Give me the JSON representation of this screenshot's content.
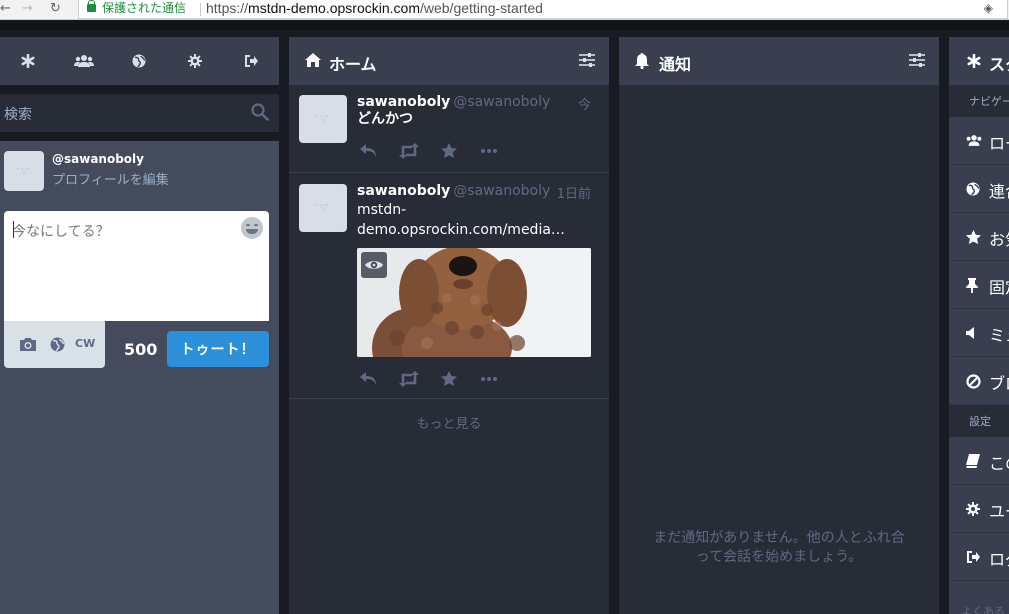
{
  "browser": {
    "secure_label": "保護された通信",
    "url_scheme": "https://",
    "url_host": "mstdn-demo.opsrockin.com",
    "url_path": "/web/getting-started"
  },
  "drawer": {
    "tab_icons": [
      "asterisk-icon",
      "users-icon",
      "globe-icon",
      "gear-icon",
      "sign-out-icon"
    ],
    "search_placeholder": "検索",
    "account_handle": "@sawanoboly",
    "edit_profile": "プロフィールを編集",
    "compose_placeholder": "今なにしてる？",
    "char_count": "500",
    "toot_button": "トゥート！",
    "cw_label": "CW"
  },
  "home": {
    "title": "ホーム",
    "statuses": [
      {
        "display_name": "sawanoboly",
        "handle": "@sawanoboly",
        "time": "今",
        "text": "どんかつ"
      },
      {
        "display_name": "sawanoboly",
        "handle": "@sawanoboly",
        "time": "1日前",
        "text_line1": "mstdn-",
        "text_line2": "demo.opsrockin.com/media…"
      }
    ],
    "load_more": "もっと見る"
  },
  "notifications": {
    "title": "通知",
    "empty_line1": "まだ通知がありません。他の人とふれ合",
    "empty_line2": "って会話を始めましょう。"
  },
  "getting_started": {
    "title": "スタ",
    "section_navigation": "ナビゲー",
    "section_settings": "設定",
    "footer": "よくある",
    "nav_items": [
      {
        "icon": "users-icon",
        "label": "ロー"
      },
      {
        "icon": "globe-icon",
        "label": "連合"
      },
      {
        "icon": "star-icon",
        "label": "お気"
      },
      {
        "icon": "pin-icon",
        "label": "固定"
      },
      {
        "icon": "volume-off-icon",
        "label": "ミュ"
      },
      {
        "icon": "ban-icon",
        "label": "ブロ"
      }
    ],
    "settings_items": [
      {
        "icon": "book-icon",
        "label": "この"
      },
      {
        "icon": "cog-icon",
        "label": "ユー"
      },
      {
        "icon": "sign-out-icon",
        "label": "ログ"
      }
    ]
  },
  "colors": {
    "accent": "#2b90d9",
    "ui_base": "#282c37",
    "ui_header": "#393f4f",
    "secure_green": "#1e8e3e"
  }
}
